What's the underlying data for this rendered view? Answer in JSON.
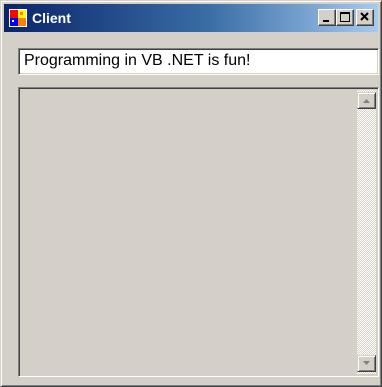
{
  "window": {
    "title": "Client",
    "controls": {
      "minimize": "minimize",
      "maximize": "maximize",
      "close": "close"
    }
  },
  "message_input": {
    "value": "Programming in VB .NET is fun!"
  },
  "output_list": {
    "items": []
  },
  "icons": {
    "app": "app-icon",
    "minimize": "minimize-icon",
    "maximize": "maximize-icon",
    "close": "close-icon",
    "scroll_up": "scroll-up-arrow-icon",
    "scroll_down": "scroll-down-arrow-icon"
  },
  "colors": {
    "titlebar_start": "#0a246a",
    "titlebar_end": "#a6caf0",
    "face": "#d4d0c8"
  }
}
